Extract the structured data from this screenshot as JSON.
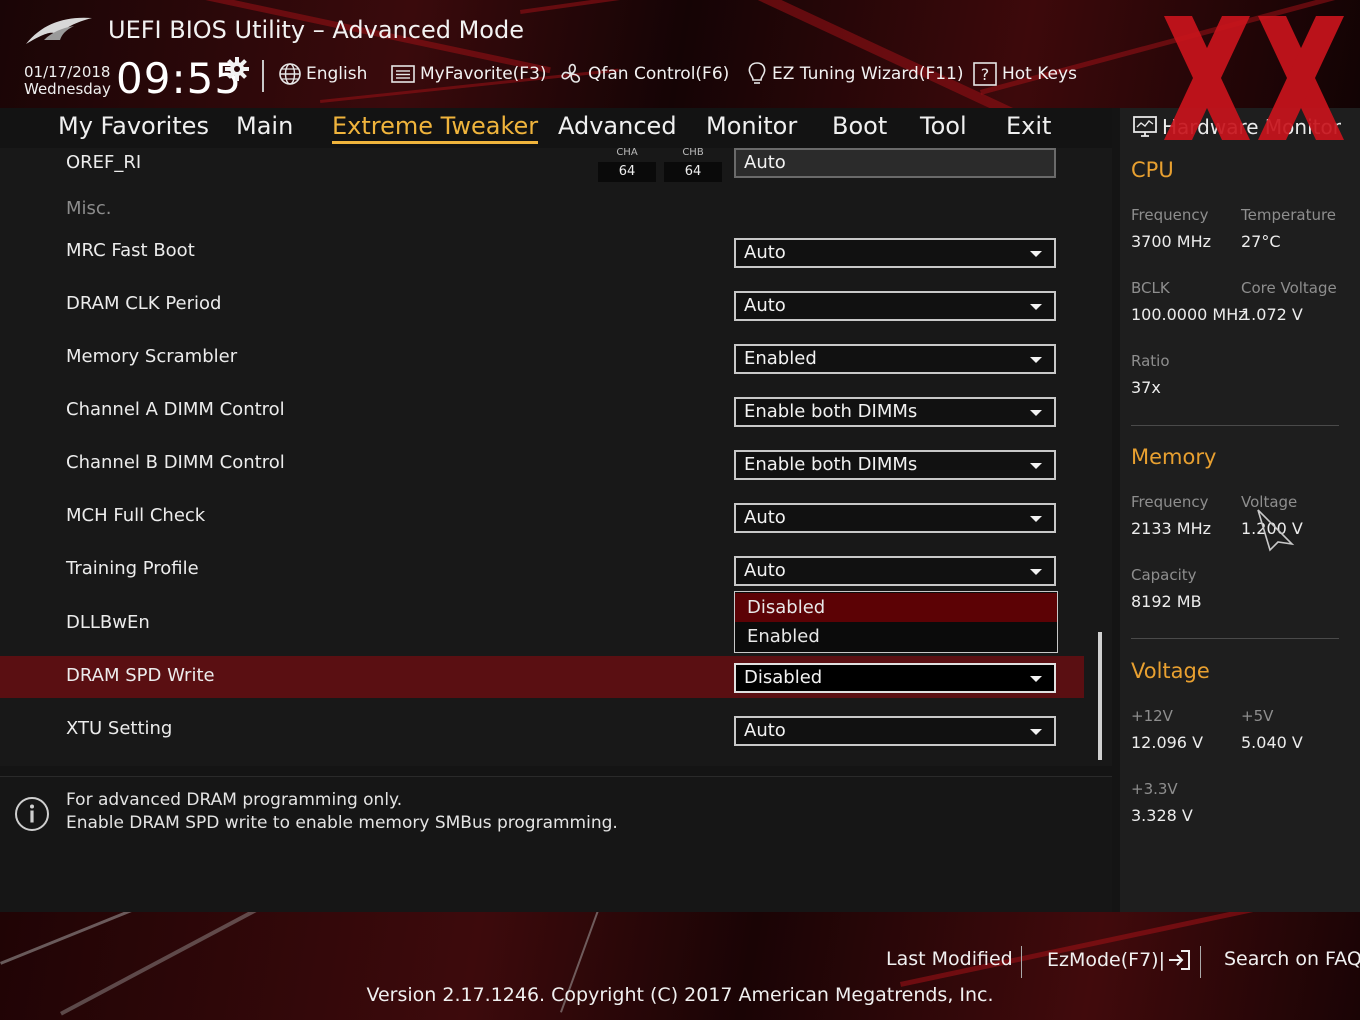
{
  "header": {
    "title": "UEFI BIOS Utility – Advanced Mode",
    "date": "01/17/2018",
    "weekday": "Wednesday",
    "time": "09:55",
    "tools": {
      "language": "English",
      "myfavorite": "MyFavorite(F3)",
      "qfan": "Qfan Control(F6)",
      "ez_tuning": "EZ Tuning Wizard(F11)",
      "hotkeys": "Hot Keys"
    }
  },
  "menu": {
    "items": [
      "My Favorites",
      "Main",
      "Extreme Tweaker",
      "Advanced",
      "Monitor",
      "Boot",
      "Tool",
      "Exit"
    ],
    "active": "Extreme Tweaker"
  },
  "settings": {
    "oref": {
      "label": "OREF_RI",
      "cha_head": "CHA",
      "chb_head": "CHB",
      "cha": "64",
      "chb": "64",
      "value": "Auto"
    },
    "misc_label": "Misc.",
    "rows": [
      {
        "label": "MRC Fast Boot",
        "value": "Auto"
      },
      {
        "label": "DRAM CLK Period",
        "value": "Auto"
      },
      {
        "label": "Memory Scrambler",
        "value": "Enabled"
      },
      {
        "label": "Channel A DIMM Control",
        "value": "Enable both DIMMs"
      },
      {
        "label": "Channel B DIMM Control",
        "value": "Enable both DIMMs"
      },
      {
        "label": "MCH Full Check",
        "value": "Auto"
      },
      {
        "label": "Training Profile",
        "value": "Auto"
      },
      {
        "label": "DLLBwEn",
        "value": ""
      },
      {
        "label": "DRAM SPD Write",
        "value": "Disabled"
      },
      {
        "label": "XTU Setting",
        "value": "Auto"
      }
    ],
    "popup_options": [
      "Disabled",
      "Enabled"
    ],
    "highlighted_option": "Disabled"
  },
  "info": {
    "line1": "For advanced DRAM programming only.",
    "line2": "Enable DRAM SPD write to enable memory SMBus programming."
  },
  "hardware_monitor": {
    "title": "Hardware Monitor",
    "cpu": {
      "section": "CPU",
      "frequency_label": "Frequency",
      "frequency": "3700 MHz",
      "temperature_label": "Temperature",
      "temperature": "27°C",
      "bclk_label": "BCLK",
      "bclk": "100.0000 MHz",
      "core_voltage_label": "Core Voltage",
      "core_voltage": "1.072 V",
      "ratio_label": "Ratio",
      "ratio": "37x"
    },
    "memory": {
      "section": "Memory",
      "frequency_label": "Frequency",
      "frequency": "2133 MHz",
      "voltage_label": "Voltage",
      "voltage": "1.200 V",
      "capacity_label": "Capacity",
      "capacity": "8192 MB"
    },
    "voltage": {
      "section": "Voltage",
      "v12_label": "+12V",
      "v12": "12.096 V",
      "v5_label": "+5V",
      "v5": "5.040 V",
      "v33_label": "+3.3V",
      "v33": "3.328 V"
    }
  },
  "footer": {
    "last_modified": "Last Modified",
    "ezmode": "EzMode(F7)|",
    "search_faq": "Search on FAQ",
    "version": "Version 2.17.1246. Copyright (C) 2017 American Megatrends, Inc."
  },
  "colors": {
    "accent": "#f0b43c",
    "section_title": "#e8a030",
    "selected_row": "#5a0f12",
    "highlight_option": "#5c0205",
    "brand_red": "#c8141c"
  }
}
